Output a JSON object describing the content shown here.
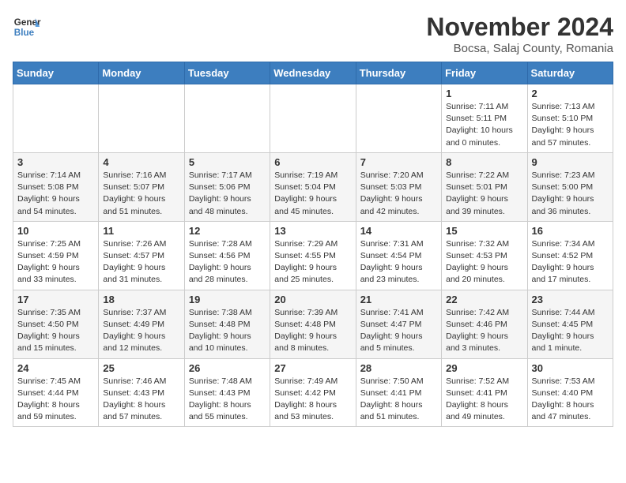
{
  "header": {
    "logo_text_line1": "General",
    "logo_text_line2": "Blue",
    "month_year": "November 2024",
    "location": "Bocsa, Salaj County, Romania"
  },
  "days_of_week": [
    "Sunday",
    "Monday",
    "Tuesday",
    "Wednesday",
    "Thursday",
    "Friday",
    "Saturday"
  ],
  "weeks": [
    [
      {
        "day": "",
        "info": ""
      },
      {
        "day": "",
        "info": ""
      },
      {
        "day": "",
        "info": ""
      },
      {
        "day": "",
        "info": ""
      },
      {
        "day": "",
        "info": ""
      },
      {
        "day": "1",
        "info": "Sunrise: 7:11 AM\nSunset: 5:11 PM\nDaylight: 10 hours\nand 0 minutes."
      },
      {
        "day": "2",
        "info": "Sunrise: 7:13 AM\nSunset: 5:10 PM\nDaylight: 9 hours\nand 57 minutes."
      }
    ],
    [
      {
        "day": "3",
        "info": "Sunrise: 7:14 AM\nSunset: 5:08 PM\nDaylight: 9 hours\nand 54 minutes."
      },
      {
        "day": "4",
        "info": "Sunrise: 7:16 AM\nSunset: 5:07 PM\nDaylight: 9 hours\nand 51 minutes."
      },
      {
        "day": "5",
        "info": "Sunrise: 7:17 AM\nSunset: 5:06 PM\nDaylight: 9 hours\nand 48 minutes."
      },
      {
        "day": "6",
        "info": "Sunrise: 7:19 AM\nSunset: 5:04 PM\nDaylight: 9 hours\nand 45 minutes."
      },
      {
        "day": "7",
        "info": "Sunrise: 7:20 AM\nSunset: 5:03 PM\nDaylight: 9 hours\nand 42 minutes."
      },
      {
        "day": "8",
        "info": "Sunrise: 7:22 AM\nSunset: 5:01 PM\nDaylight: 9 hours\nand 39 minutes."
      },
      {
        "day": "9",
        "info": "Sunrise: 7:23 AM\nSunset: 5:00 PM\nDaylight: 9 hours\nand 36 minutes."
      }
    ],
    [
      {
        "day": "10",
        "info": "Sunrise: 7:25 AM\nSunset: 4:59 PM\nDaylight: 9 hours\nand 33 minutes."
      },
      {
        "day": "11",
        "info": "Sunrise: 7:26 AM\nSunset: 4:57 PM\nDaylight: 9 hours\nand 31 minutes."
      },
      {
        "day": "12",
        "info": "Sunrise: 7:28 AM\nSunset: 4:56 PM\nDaylight: 9 hours\nand 28 minutes."
      },
      {
        "day": "13",
        "info": "Sunrise: 7:29 AM\nSunset: 4:55 PM\nDaylight: 9 hours\nand 25 minutes."
      },
      {
        "day": "14",
        "info": "Sunrise: 7:31 AM\nSunset: 4:54 PM\nDaylight: 9 hours\nand 23 minutes."
      },
      {
        "day": "15",
        "info": "Sunrise: 7:32 AM\nSunset: 4:53 PM\nDaylight: 9 hours\nand 20 minutes."
      },
      {
        "day": "16",
        "info": "Sunrise: 7:34 AM\nSunset: 4:52 PM\nDaylight: 9 hours\nand 17 minutes."
      }
    ],
    [
      {
        "day": "17",
        "info": "Sunrise: 7:35 AM\nSunset: 4:50 PM\nDaylight: 9 hours\nand 15 minutes."
      },
      {
        "day": "18",
        "info": "Sunrise: 7:37 AM\nSunset: 4:49 PM\nDaylight: 9 hours\nand 12 minutes."
      },
      {
        "day": "19",
        "info": "Sunrise: 7:38 AM\nSunset: 4:48 PM\nDaylight: 9 hours\nand 10 minutes."
      },
      {
        "day": "20",
        "info": "Sunrise: 7:39 AM\nSunset: 4:48 PM\nDaylight: 9 hours\nand 8 minutes."
      },
      {
        "day": "21",
        "info": "Sunrise: 7:41 AM\nSunset: 4:47 PM\nDaylight: 9 hours\nand 5 minutes."
      },
      {
        "day": "22",
        "info": "Sunrise: 7:42 AM\nSunset: 4:46 PM\nDaylight: 9 hours\nand 3 minutes."
      },
      {
        "day": "23",
        "info": "Sunrise: 7:44 AM\nSunset: 4:45 PM\nDaylight: 9 hours\nand 1 minute."
      }
    ],
    [
      {
        "day": "24",
        "info": "Sunrise: 7:45 AM\nSunset: 4:44 PM\nDaylight: 8 hours\nand 59 minutes."
      },
      {
        "day": "25",
        "info": "Sunrise: 7:46 AM\nSunset: 4:43 PM\nDaylight: 8 hours\nand 57 minutes."
      },
      {
        "day": "26",
        "info": "Sunrise: 7:48 AM\nSunset: 4:43 PM\nDaylight: 8 hours\nand 55 minutes."
      },
      {
        "day": "27",
        "info": "Sunrise: 7:49 AM\nSunset: 4:42 PM\nDaylight: 8 hours\nand 53 minutes."
      },
      {
        "day": "28",
        "info": "Sunrise: 7:50 AM\nSunset: 4:41 PM\nDaylight: 8 hours\nand 51 minutes."
      },
      {
        "day": "29",
        "info": "Sunrise: 7:52 AM\nSunset: 4:41 PM\nDaylight: 8 hours\nand 49 minutes."
      },
      {
        "day": "30",
        "info": "Sunrise: 7:53 AM\nSunset: 4:40 PM\nDaylight: 8 hours\nand 47 minutes."
      }
    ]
  ]
}
